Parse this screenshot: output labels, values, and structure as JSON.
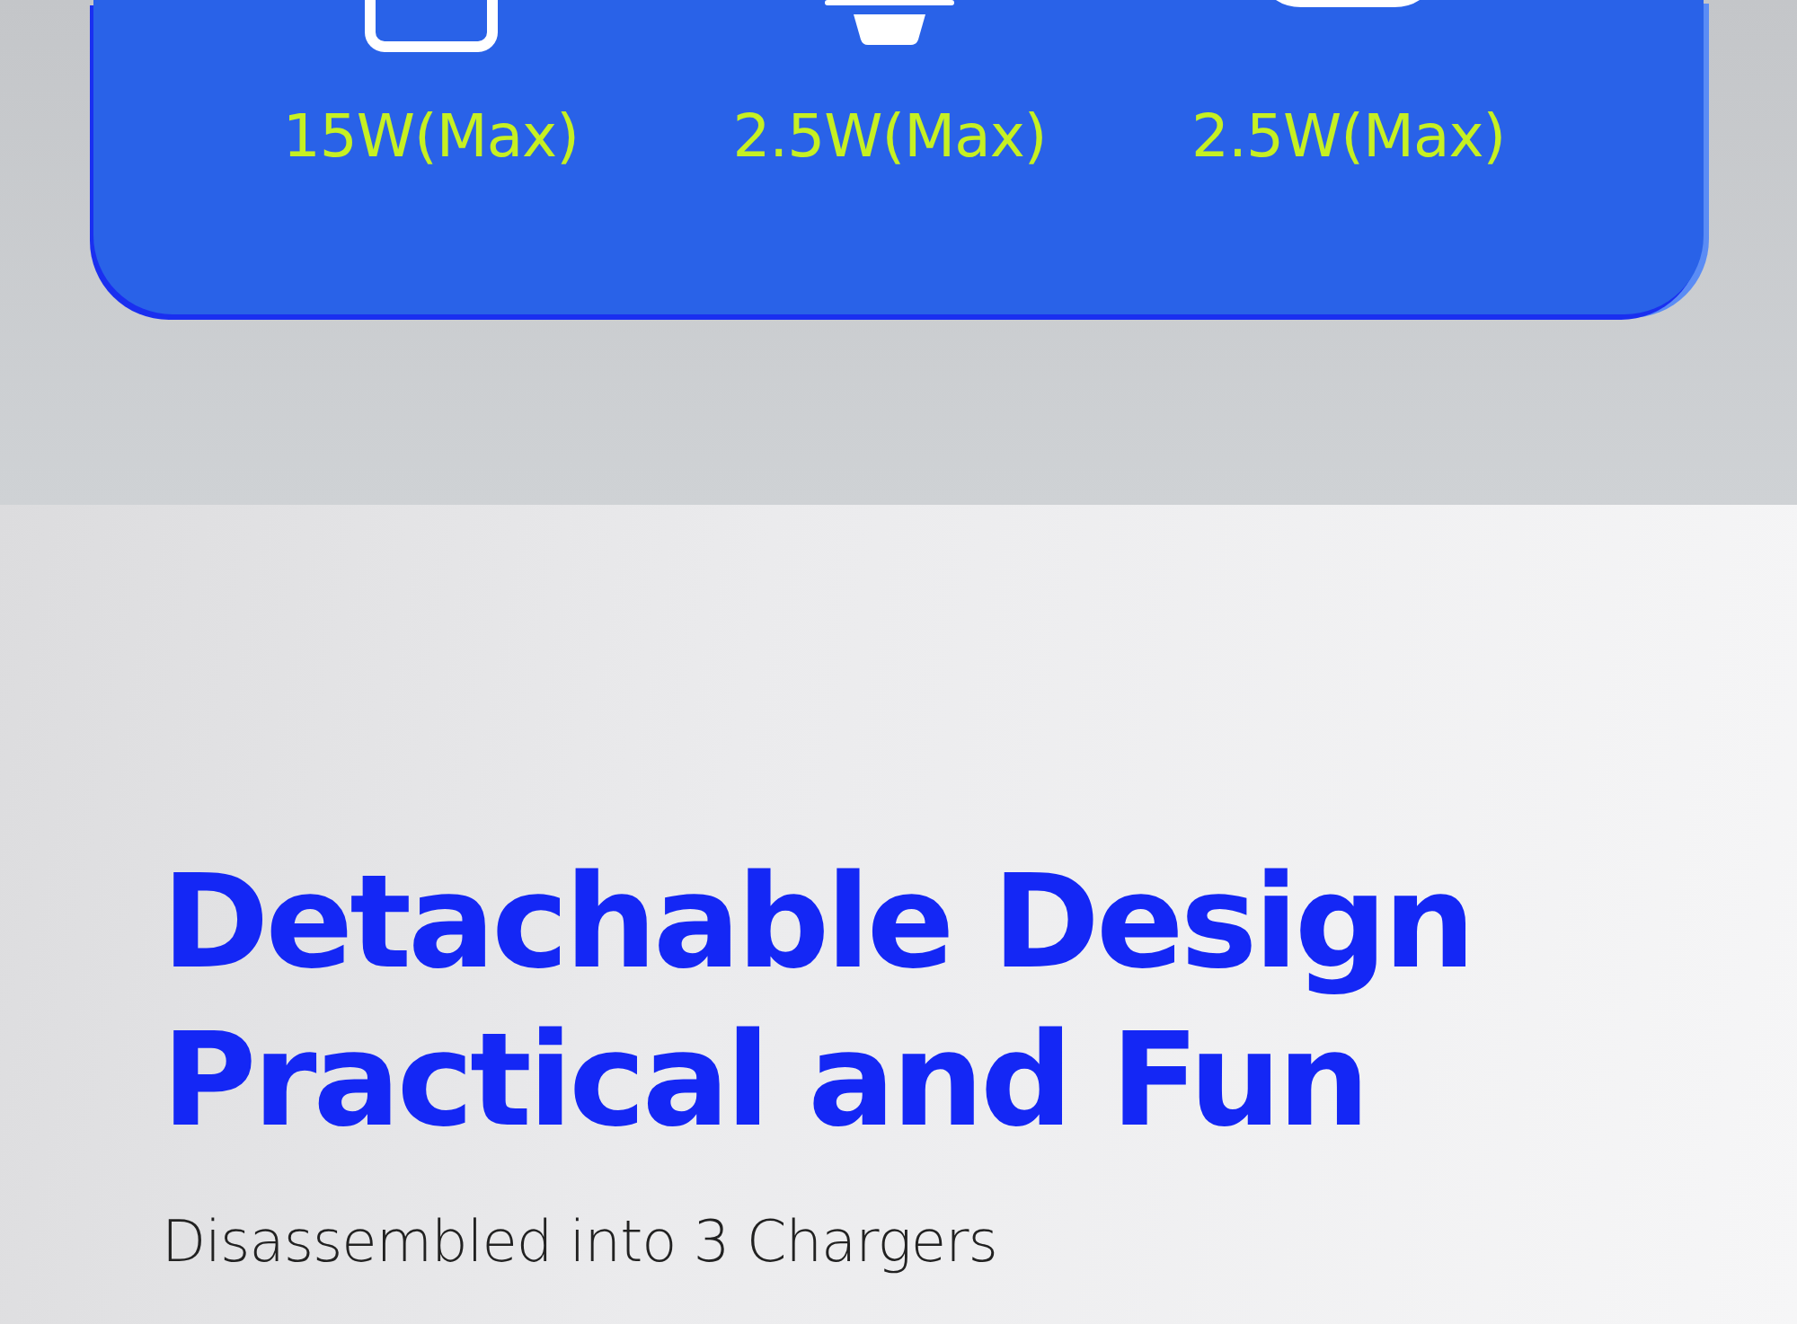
{
  "power_card": {
    "outputs": [
      {
        "kind": "phone",
        "label": "15W(Max)"
      },
      {
        "kind": "watch",
        "label": "2.5W(Max)"
      },
      {
        "kind": "earbuds",
        "label": "2.5W(Max)"
      }
    ]
  },
  "feature": {
    "title_lines": [
      "Detachable Design",
      "Practical and Fun"
    ],
    "subtitle": "Disassembled into 3 Chargers"
  }
}
